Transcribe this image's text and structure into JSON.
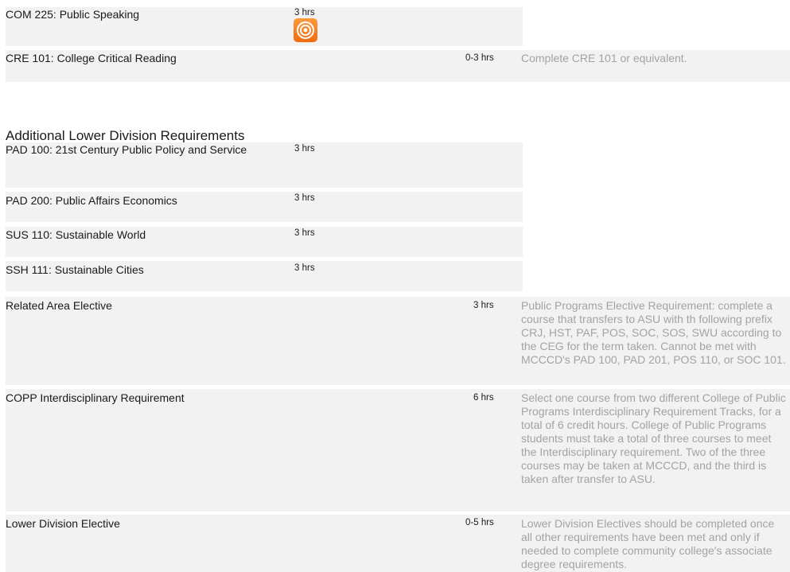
{
  "rows_top": [
    {
      "course": "COM 225: Public Speaking",
      "hours": "3 hrs",
      "note": "",
      "badge": "speaking-badge-icon"
    },
    {
      "course": "CRE 101: College Critical Reading",
      "hours": "0-3 hrs",
      "note": "Complete CRE 101 or equivalent."
    }
  ],
  "section": {
    "title": "Additional Lower Division Requirements"
  },
  "rows_additional": [
    {
      "course": "PAD 100: 21st Century Public Policy and Service",
      "hours": "3 hrs",
      "note": ""
    },
    {
      "course": "PAD 200: Public Affairs Economics",
      "hours": "3 hrs",
      "note": ""
    },
    {
      "course": "SUS 110: Sustainable World",
      "hours": "3 hrs",
      "note": ""
    },
    {
      "course": "SSH 111: Sustainable Cities",
      "hours": "3 hrs",
      "note": ""
    },
    {
      "course": "Related Area Elective",
      "hours": "3 hrs",
      "note": "Public Programs Elective Requirement: complete a course that transfers to ASU with th following prefix CRJ, HST, PAF, POS, SOC, SOS, SWU according to the CEG for the term taken. Cannot be met with MCCCD's PAD 100, PAD 201, POS 110, or SOC 101."
    },
    {
      "course": "COPP Interdisciplinary Requirement",
      "hours": "6 hrs",
      "note": "Select one course from two different College of Public Programs Interdisciplinary Requirement Tracks, for a total of 6 credit hours. College of Public Programs students must take a total of three courses to meet the Interdisciplinary requirement. Two of the three courses may be taken at MCCCD, and the third is taken after transfer to ASU."
    },
    {
      "course": "Lower Division Elective",
      "hours": "0-5 hrs",
      "note": "Lower Division Electives should be completed once all other requirements have been met and only if needed to complete community college's associate degree requirements."
    }
  ]
}
